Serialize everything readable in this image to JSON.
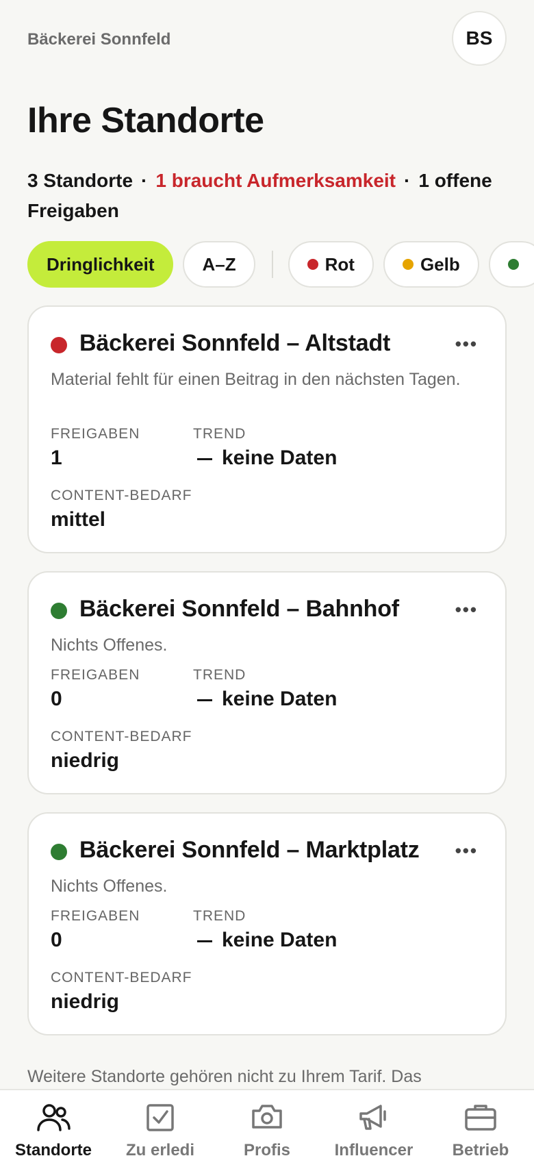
{
  "header": {
    "brand": "Bäckerei Sonnfeld",
    "avatar_initials": "BS"
  },
  "title": "Ihre Standorte",
  "summary": {
    "count": "3 Standorte",
    "separator": "·",
    "alert": "1 braucht Aufmerksamkeit",
    "pending": "1 offene Freigaben"
  },
  "filters": {
    "sort": [
      {
        "label": "Dringlichkeit",
        "active": true
      },
      {
        "label": "A–Z",
        "active": false
      }
    ],
    "status": [
      {
        "label": "Rot",
        "color": "#c8262b"
      },
      {
        "label": "Gelb",
        "color": "#e6a400"
      },
      {
        "label": "",
        "color": "#2e7d32"
      }
    ]
  },
  "labels": {
    "freigaben": "FREIGABEN",
    "trend": "TREND",
    "content_bedarf": "CONTENT-BEDARF",
    "more": "•••"
  },
  "locations": [
    {
      "name": "Bäckerei Sonnfeld – Altstadt",
      "status_color": "#c8262b",
      "description": "Material fehlt für einen Beitrag in den nächsten Tagen.",
      "freigaben": "1",
      "trend": "keine Daten",
      "content_bedarf": "mittel"
    },
    {
      "name": "Bäckerei Sonnfeld – Bahnhof",
      "status_color": "#2e7d32",
      "description": "Nichts Offenes.",
      "freigaben": "0",
      "trend": "keine Daten",
      "content_bedarf": "niedrig"
    },
    {
      "name": "Bäckerei Sonnfeld – Marktplatz",
      "status_color": "#2e7d32",
      "description": "Nichts Offenes.",
      "freigaben": "0",
      "trend": "keine Daten",
      "content_bedarf": "niedrig"
    }
  ],
  "footer_note": "Weitere Standorte gehören nicht zu Ihrem Tarif. Das",
  "nav": [
    {
      "label": "Standorte",
      "icon": "users-icon",
      "active": true
    },
    {
      "label": "Zu erledi",
      "icon": "checkbox-icon",
      "active": false
    },
    {
      "label": "Profis",
      "icon": "camera-icon",
      "active": false
    },
    {
      "label": "Influencer",
      "icon": "megaphone-icon",
      "active": false
    },
    {
      "label": "Betrieb",
      "icon": "briefcase-icon",
      "active": false
    }
  ]
}
